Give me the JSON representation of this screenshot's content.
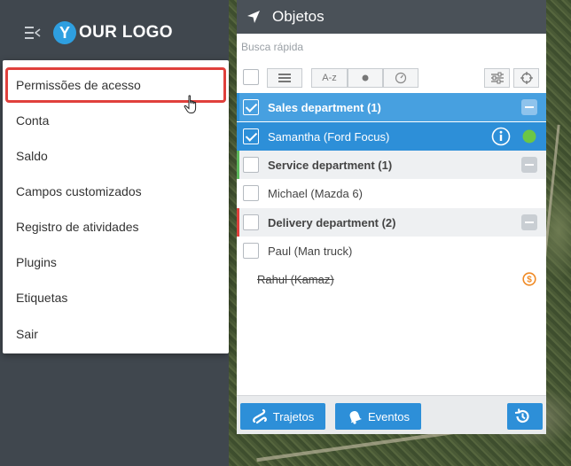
{
  "header": {
    "logo_letter": "Y",
    "logo_text": "OUR LOGO"
  },
  "user_menu": {
    "items": [
      {
        "label": "Permissões de acesso",
        "active": true
      },
      {
        "label": "Conta"
      },
      {
        "label": "Saldo"
      },
      {
        "label": "Campos customizados"
      },
      {
        "label": "Registro de atividades"
      },
      {
        "label": "Plugins"
      },
      {
        "label": "Etiquetas"
      },
      {
        "label": "Sair"
      }
    ]
  },
  "objects_panel": {
    "title": "Objetos",
    "search_placeholder": "Busca rápida",
    "sort_label": "A-z",
    "groups": [
      {
        "name": "Sales department (1)",
        "selected": true,
        "stripe_color": "#2d8fd8",
        "items": [
          {
            "name": "Samantha (Ford Focus)",
            "selected": true,
            "status_color": "#6cc644",
            "has_info": true
          }
        ]
      },
      {
        "name": "Service department (1)",
        "selected": false,
        "stripe_color": "#5cb85c",
        "items": [
          {
            "name": "Michael (Mazda 6)"
          }
        ]
      },
      {
        "name": "Delivery department (2)",
        "selected": false,
        "stripe_color": "#e0403c",
        "items": [
          {
            "name": "Paul (Man truck)"
          },
          {
            "name": "Rahul (Kamaz)",
            "disabled": true,
            "alert_icon": "dollar-icon",
            "alert_color": "#f08a24"
          }
        ]
      }
    ],
    "footer": {
      "tracks_label": "Trajetos",
      "events_label": "Eventos"
    }
  },
  "colors": {
    "accent": "#2d8fd8",
    "sidebar_bg": "#40474e",
    "active_outline": "#e0403c"
  }
}
